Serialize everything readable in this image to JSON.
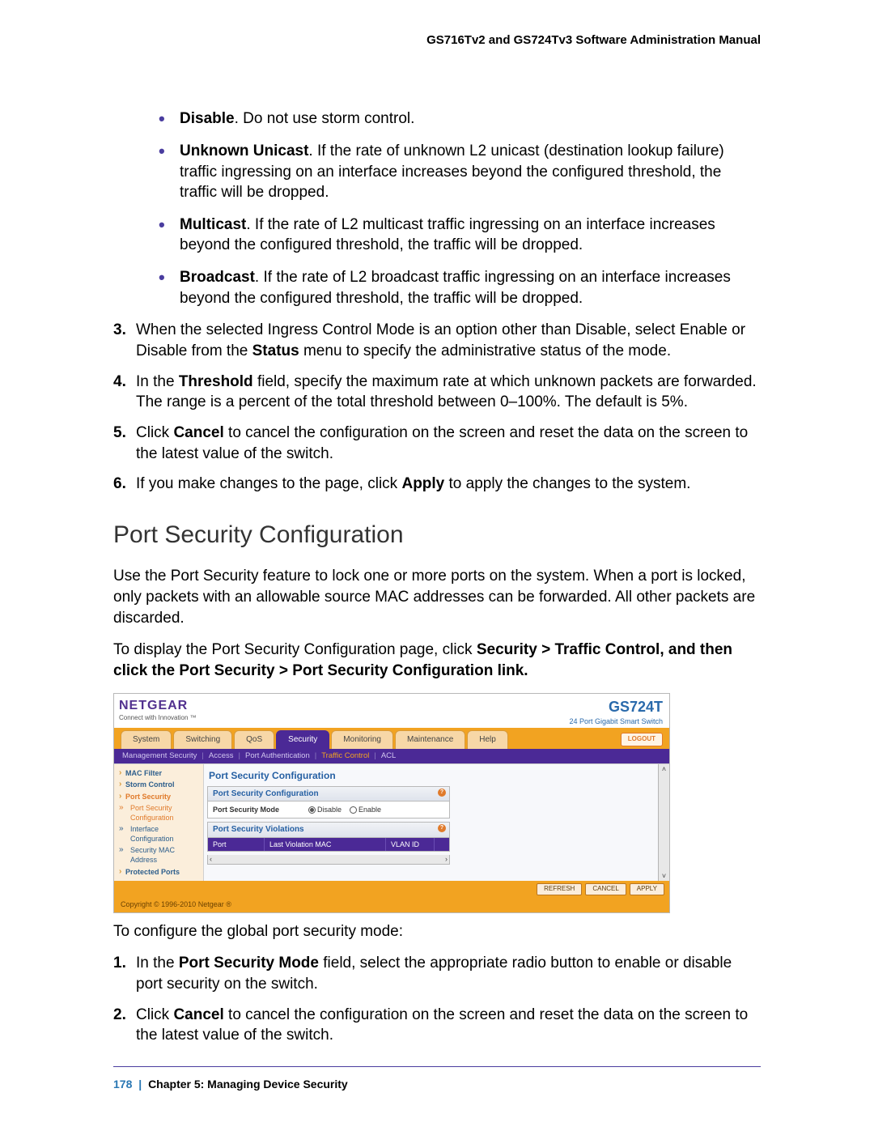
{
  "header": {
    "text": "GS716Tv2 and GS724Tv3 Software Administration Manual"
  },
  "bullets": [
    {
      "bold": "Disable",
      "text": ". Do not use storm control."
    },
    {
      "bold": "Unknown Unicast",
      "text": ". If the rate of unknown L2 unicast (destination lookup failure) traffic ingressing on an interface increases beyond the configured threshold, the traffic will be dropped."
    },
    {
      "bold": "Multicast",
      "text": ". If the rate of L2 multicast traffic ingressing on an interface increases beyond the configured threshold, the traffic will be dropped."
    },
    {
      "bold": "Broadcast",
      "text": ". If the rate of L2 broadcast traffic ingressing on an interface increases beyond the configured threshold, the traffic will be dropped."
    }
  ],
  "steps": {
    "s3a": "When the selected Ingress Control Mode is an option other than Disable, select Enable or Disable from the ",
    "s3b": "Status",
    "s3c": " menu to specify the administrative status of the mode.",
    "s4a": "In the ",
    "s4b": "Threshold",
    "s4c": " field, specify the maximum rate at which unknown packets are forwarded. The range is a percent of the total threshold between 0–100%. The default is 5%.",
    "s5a": "Click ",
    "s5b": "Cancel",
    "s5c": " to cancel the configuration on the screen and reset the data on the screen to the latest value of the switch.",
    "s6a": "If you make changes to the page, click ",
    "s6b": "Apply",
    "s6c": " to apply the changes to the system."
  },
  "section_title": "Port Security Configuration",
  "para1": "Use the Port Security feature to lock one or more ports on the system. When a port is locked, only packets with an allowable source MAC addresses can be forwarded. All other packets are discarded.",
  "para2a": "To display the Port Security Configuration page, click ",
  "para2b": "Security > Traffic Control, and then click the Port Security > Port Security Configuration link.",
  "embedded": {
    "brand": "NETGEAR",
    "brand_sub": "Connect with Innovation ™",
    "model": "GS724T",
    "model_desc": "24 Port Gigabit Smart Switch",
    "tabs": [
      "System",
      "Switching",
      "QoS",
      "Security",
      "Monitoring",
      "Maintenance",
      "Help"
    ],
    "active_tab": "Security",
    "logout": "LOGOUT",
    "subnav": [
      "Management Security",
      "Access",
      "Port Authentication",
      "Traffic Control",
      "ACL"
    ],
    "subnav_active": "Traffic Control",
    "sidebar": {
      "items": [
        "MAC Filter",
        "Storm Control",
        "Port Security",
        "Protected Ports"
      ],
      "selected": "Port Security",
      "subs": [
        "Port Security Configuration",
        "Interface Configuration",
        "Security MAC Address"
      ]
    },
    "panel_title": "Port Security Configuration",
    "box1_head": "Port Security Configuration",
    "box1_label": "Port Security Mode",
    "radio_disable": "Disable",
    "radio_enable": "Enable",
    "box2_head": "Port Security Violations",
    "vio_cols": [
      "Port",
      "Last Violation MAC",
      "VLAN ID"
    ],
    "buttons": [
      "REFRESH",
      "CANCEL",
      "APPLY"
    ],
    "copyright": "Copyright © 1996-2010 Netgear ®"
  },
  "after1": "To configure the global port security mode:",
  "after_steps": {
    "s1a": "In the ",
    "s1b": "Port Security Mode",
    "s1c": " field, select the appropriate radio button to enable or disable port security on the switch.",
    "s2a": "Click ",
    "s2b": "Cancel",
    "s2c": " to cancel the configuration on the screen and reset the data on the screen to the latest value of the switch."
  },
  "footer": {
    "page": "178",
    "sep": "|",
    "chapter": "Chapter 5:  Managing Device Security"
  }
}
